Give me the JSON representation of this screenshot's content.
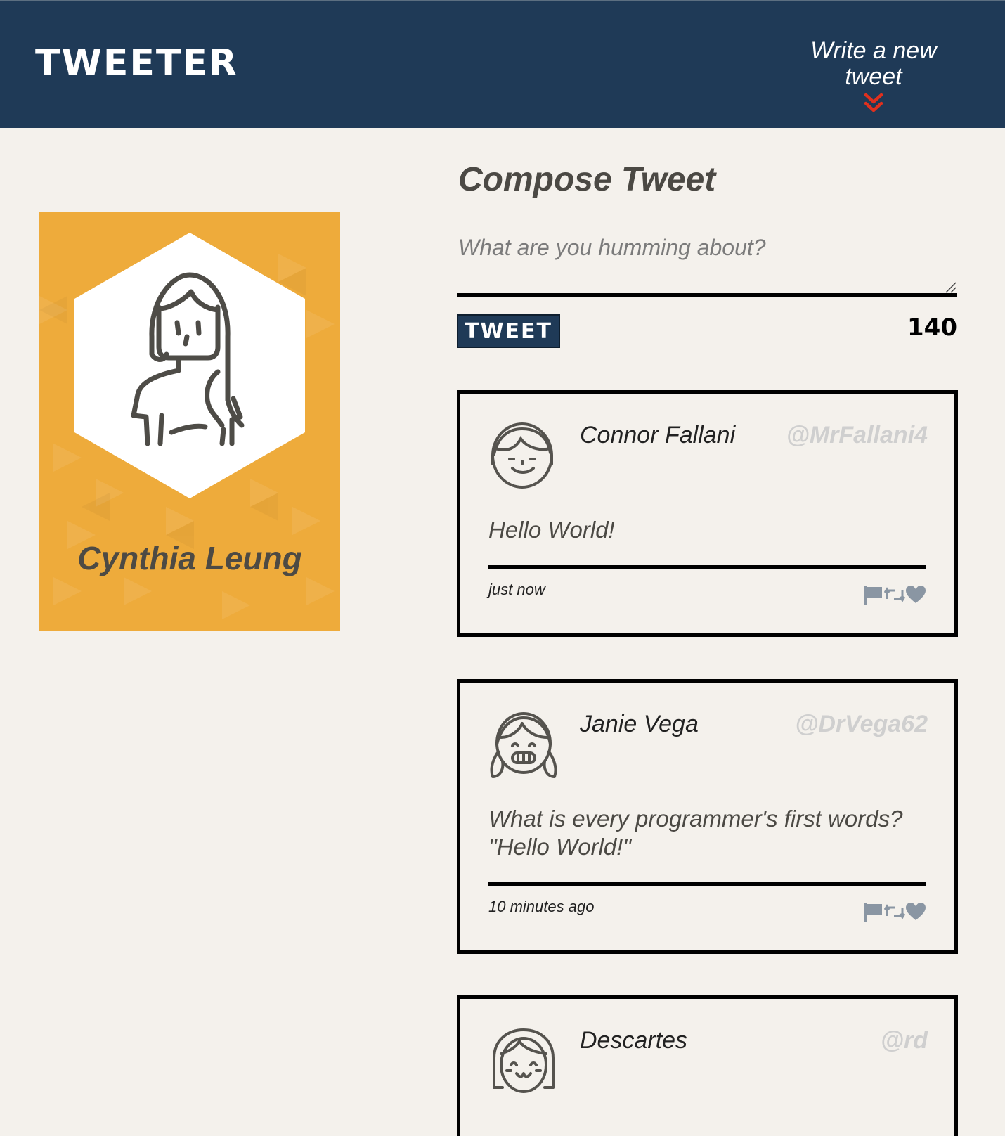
{
  "header": {
    "brand": "TWEETER",
    "nav_toggle": "Write a new tweet"
  },
  "profile": {
    "name": "Cynthia Leung"
  },
  "compose": {
    "title": "Compose Tweet",
    "placeholder": "What are you humming about?",
    "button_label": "TWEET",
    "counter": "140"
  },
  "tweets": [
    {
      "name": "Connor Fallani",
      "handle": "@MrFallani4",
      "content": "Hello World!",
      "time": "just now",
      "avatar_icon": "boy-face-icon"
    },
    {
      "name": "Janie Vega",
      "handle": "@DrVega62",
      "content": "What is every programmer's first words? \"Hello World!\"",
      "time": "10 minutes ago",
      "avatar_icon": "girl-pigtails-face-icon"
    },
    {
      "name": "Descartes",
      "handle": "@rd",
      "content": "",
      "time": "",
      "avatar_icon": "girl-bob-face-icon"
    }
  ],
  "colors": {
    "header_bg": "#1f3a57",
    "page_bg": "#f4f1ec",
    "profile_bg": "#eeab3b",
    "accent_red": "#e0301e",
    "action_icons": "#8a96a3"
  }
}
